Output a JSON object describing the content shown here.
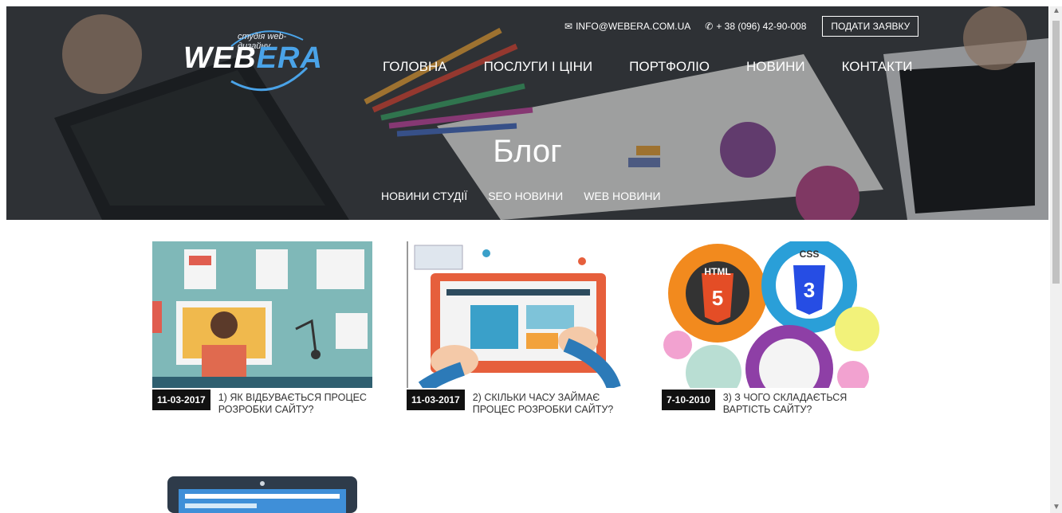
{
  "header": {
    "logo": {
      "subtitle": "студія web-дизайну",
      "word_web": "WEB",
      "word_era": "ERA"
    },
    "email": "INFO@WEBERA.COM.UA",
    "phone": "+ 38 (096) 42-90-008",
    "cta": "ПОДАТИ ЗАЯВКУ",
    "nav": [
      "ГОЛОВНА",
      "ПОСЛУГИ І ЦІНИ",
      "ПОРТФОЛІО",
      "НОВИНИ",
      "КОНТАКТИ"
    ]
  },
  "hero": {
    "title": "Блог",
    "subnav": [
      "НОВИНИ СТУДІЇ",
      "SEO НОВИНИ",
      "WEB НОВИНИ"
    ]
  },
  "posts": [
    {
      "date": "11-03-2017",
      "title": "1) ЯК ВІДБУВАЄТЬСЯ ПРОЦЕС РОЗРОБКИ САЙТУ?"
    },
    {
      "date": "11-03-2017",
      "title": "2) СКІЛЬКИ ЧАСУ ЗАЙМАЄ ПРОЦЕС РОЗРОБКИ САЙТУ?"
    },
    {
      "date": "7-10-2010",
      "title": "3) З ЧОГО СКЛАДАЄТЬСЯ ВАРТІСТЬ САЙТУ?"
    }
  ],
  "thumb_labels": {
    "html": "HTML",
    "html_num": "5",
    "css": "CSS",
    "css_num": "3"
  },
  "colors": {
    "accent": "#4aa3e8",
    "date_bg": "#111111"
  }
}
